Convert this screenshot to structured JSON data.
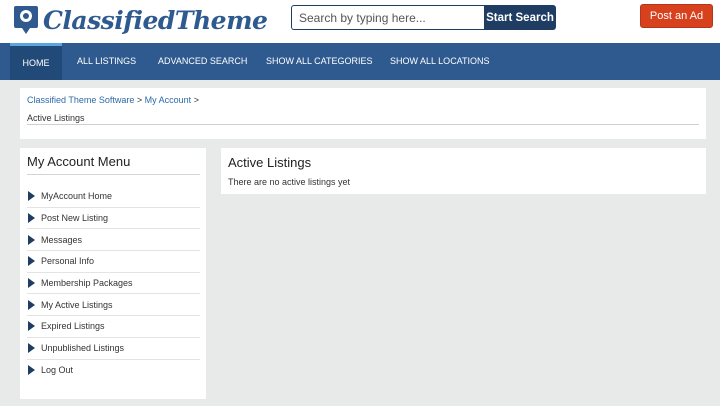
{
  "header": {
    "logo_text": "ClassifiedTheme",
    "search_placeholder": "Search by typing here...",
    "search_button": "Search",
    "search_button_full": "Start Search",
    "post_button": "Post an Ad"
  },
  "nav": {
    "items": [
      "Home",
      "All Listings",
      "Advanced Search",
      "Show All Categories",
      "Show All Locations"
    ],
    "active_index": 0
  },
  "breadcrumb": {
    "link1": "Classified Theme Software",
    "sep1": " > ",
    "link2": "My Account",
    "sep2": " >",
    "current": "Active Listings"
  },
  "sidebar": {
    "title": "My Account Menu",
    "items": [
      "MyAccount Home",
      "Post New Listing",
      "Messages",
      "Personal Info",
      "Membership Packages",
      "My Active Listings",
      "Expired Listings",
      "Unpublished Listings",
      "Log Out"
    ]
  },
  "main": {
    "title": "Active Listings",
    "message": "There are no active listings yet"
  },
  "colors": {
    "brand_blue": "#2e5a8f",
    "dark_blue": "#1f3c63",
    "post_red": "#d8411e",
    "page_bg": "#e8eae9",
    "active_tab_bar": "#5aa7e0"
  }
}
